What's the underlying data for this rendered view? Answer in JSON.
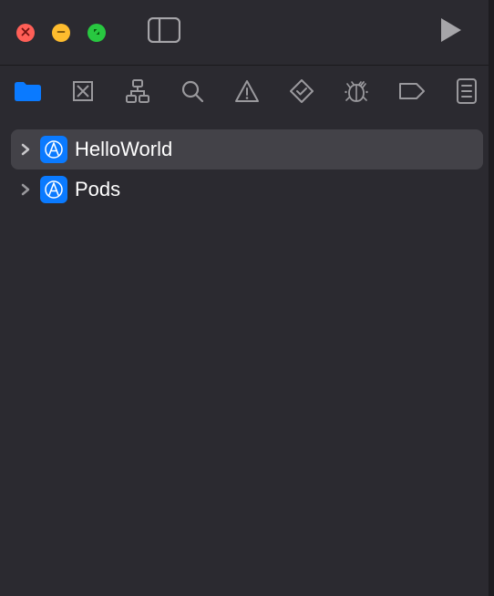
{
  "colors": {
    "accent": "#0a7aff",
    "background": "#2b2a30",
    "row_selected": "#434248"
  },
  "traffic_lights": {
    "close": "close",
    "minimize": "minimize",
    "maximize": "maximize"
  },
  "toolbar": {
    "sidebar_toggle": "sidebar-toggle",
    "run": "run"
  },
  "navigator_tabs": [
    {
      "name": "project",
      "icon": "folder-icon",
      "active": true
    },
    {
      "name": "source-control",
      "icon": "source-control-icon",
      "active": false
    },
    {
      "name": "symbols",
      "icon": "symbols-icon",
      "active": false
    },
    {
      "name": "find",
      "icon": "search-icon",
      "active": false
    },
    {
      "name": "issues",
      "icon": "warning-icon",
      "active": false
    },
    {
      "name": "tests",
      "icon": "tests-icon",
      "active": false
    },
    {
      "name": "debug",
      "icon": "debug-icon",
      "active": false
    },
    {
      "name": "breakpoints",
      "icon": "breakpoints-icon",
      "active": false
    },
    {
      "name": "reports",
      "icon": "reports-icon",
      "active": false
    }
  ],
  "tree": {
    "items": [
      {
        "label": "HelloWorld",
        "icon": "xcode-project-icon",
        "selected": true,
        "expanded": false
      },
      {
        "label": "Pods",
        "icon": "xcode-project-icon",
        "selected": false,
        "expanded": false
      }
    ]
  }
}
